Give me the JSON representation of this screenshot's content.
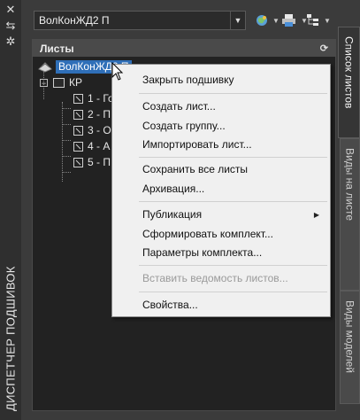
{
  "left_strip": {
    "title": "ДИСПЕТЧЕР ПОДШИВОК",
    "icons": [
      "close-icon",
      "collapse-icon",
      "settings-icon"
    ]
  },
  "toolbar": {
    "sheetset_value": "ВолКонЖД2 П",
    "buttons": [
      "sheet-set-globe-icon",
      "printer-icon",
      "sheet-tree-icon"
    ]
  },
  "panel": {
    "header": "Листы",
    "tree": {
      "root": "ВолКонЖД2 П",
      "group": "КР",
      "sheets": [
        "1 - Го",
        "2 - П",
        "3 - О",
        "4 - А",
        "5 - П"
      ]
    }
  },
  "right_tabs": [
    "Список листов",
    "Виды на листе",
    "Виды моделей"
  ],
  "context_menu": {
    "items": [
      {
        "label": "Закрыть подшивку",
        "enabled": true
      },
      {
        "label": "Создать лист...",
        "enabled": true
      },
      {
        "label": "Создать группу...",
        "enabled": true
      },
      {
        "label": "Импортировать лист...",
        "enabled": true
      },
      {
        "label": "Сохранить все листы",
        "enabled": true
      },
      {
        "label": "Архивация...",
        "enabled": true
      },
      {
        "label": "Публикация",
        "enabled": true,
        "submenu": true
      },
      {
        "label": "Сформировать комплект...",
        "enabled": true
      },
      {
        "label": "Параметры комплекта...",
        "enabled": true
      },
      {
        "label": "Вставить ведомость листов...",
        "enabled": false
      },
      {
        "label": "Свойства...",
        "enabled": true
      }
    ]
  },
  "colors": {
    "background": "#3b3b3b",
    "selection": "#2f6fb8",
    "menu_bg": "#f0f0f0"
  }
}
